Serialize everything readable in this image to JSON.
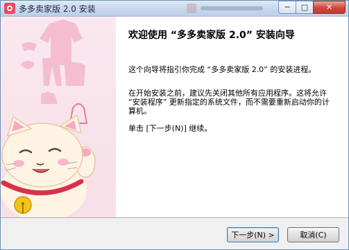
{
  "window": {
    "title": "多多卖家版 2.0 安装"
  },
  "caption_buttons": {
    "minimize": "─",
    "maximize": "□",
    "close": "✕"
  },
  "content": {
    "heading": "欢迎使用 “多多卖家版 2.0” 安装向导",
    "paragraph1": "这个向导将指引你完成 “多多卖家版 2.0” 的安装进程。",
    "paragraph2": "在开始安装之前，建议先关闭其他所有应用程序。这将允许 “安装程序” 更新指定的系统文件，而不需要重新启动你的计算机。",
    "paragraph3": "单击 [下一步(N)] 继续。"
  },
  "buttons": {
    "next": "下一步(N) >",
    "cancel": "取消(C)"
  },
  "icons": {
    "app": "app-icon",
    "minimize": "minimize-icon",
    "maximize": "maximize-icon",
    "close": "close-icon"
  },
  "colors": {
    "side_panel_bg": "#f8e1ea",
    "accent_pink": "#e8799a",
    "close_red": "#c9443a"
  }
}
